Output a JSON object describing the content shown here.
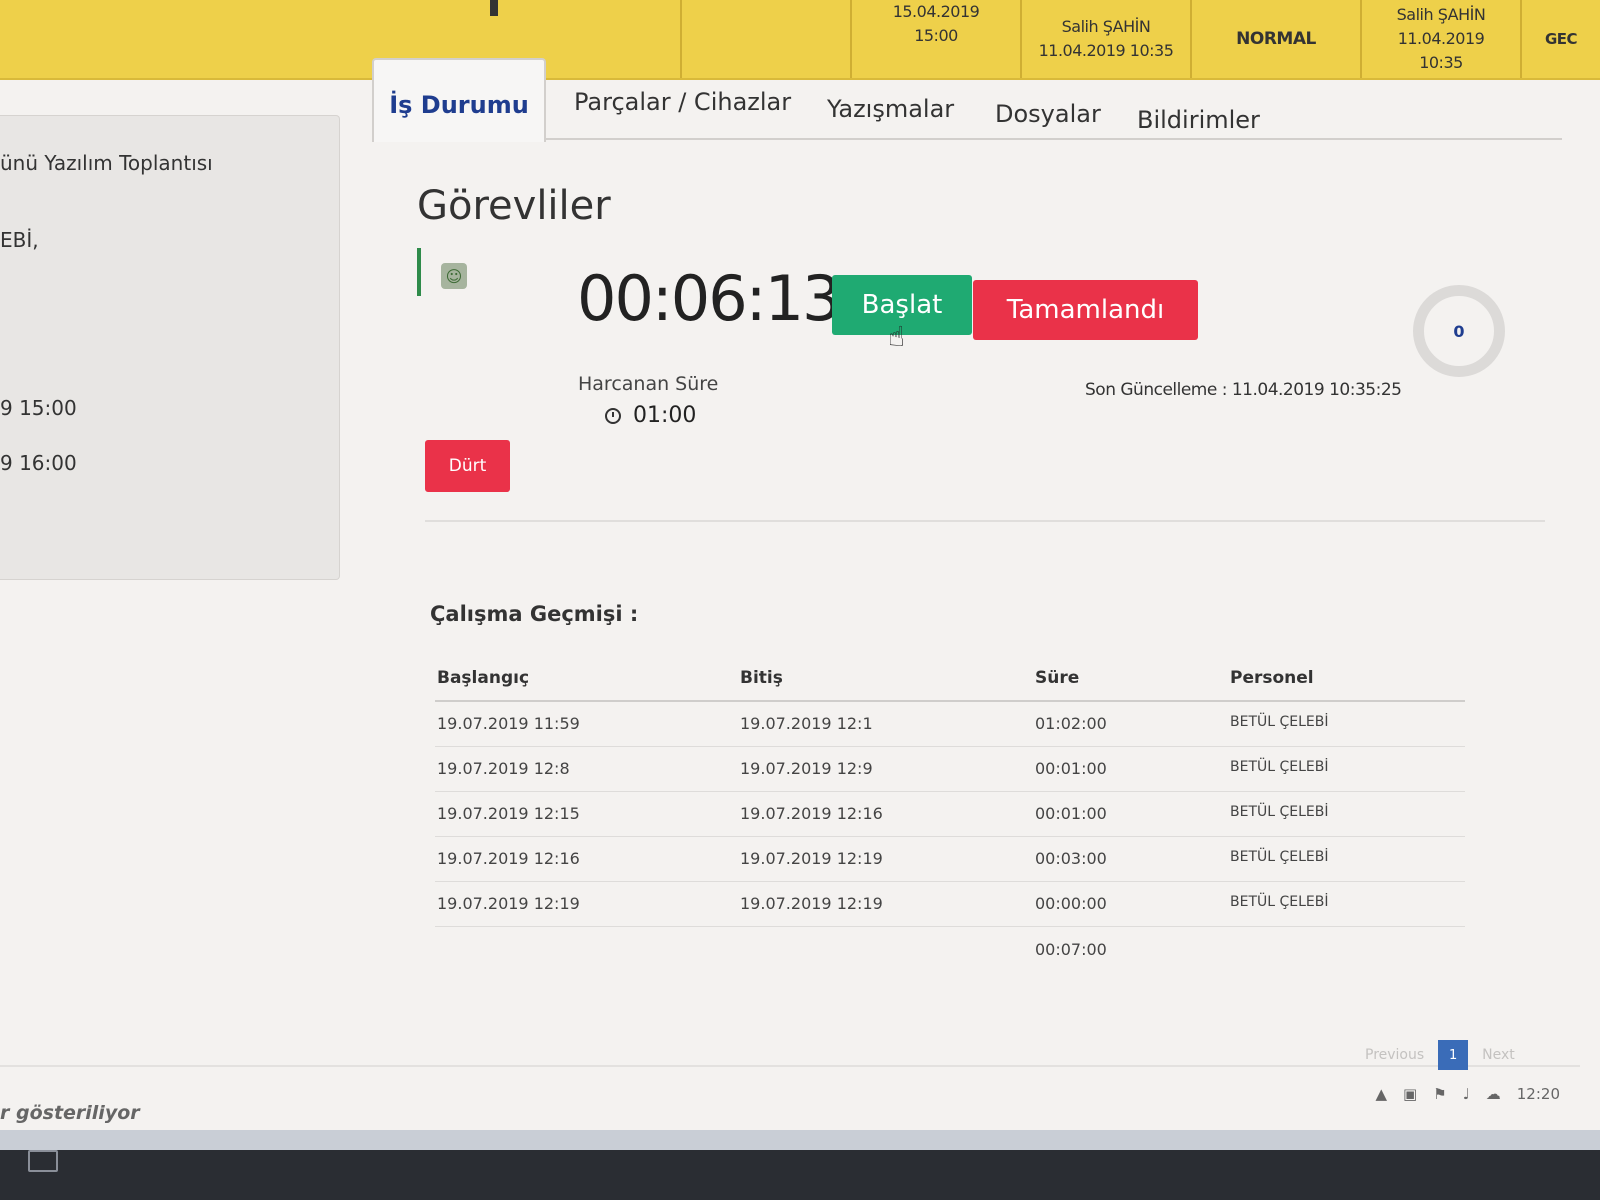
{
  "topbar": {
    "date1": "15.04.2019",
    "time1": "15:00",
    "user1": "Salih ŞAHİN",
    "stamp1": "11.04.2019 10:35",
    "priority": "NORMAL",
    "user2": "Salih ŞAHİN",
    "date2": "11.04.2019",
    "time2": "10:35",
    "extra": "GEC"
  },
  "left_panel": {
    "title_fragment": "ünü Yazılım Toplantısı",
    "name_fragment": "EBİ,",
    "start_fragment": "9 15:00",
    "end_fragment": "9 16:00"
  },
  "tabs": [
    {
      "label": "İş Durumu",
      "active": true
    },
    {
      "label": "Parçalar / Cihazlar"
    },
    {
      "label": "Yazışmalar"
    },
    {
      "label": "Dosyalar"
    },
    {
      "label": "Bildirimler"
    }
  ],
  "section_title": "Görevliler",
  "timer": "00:06:13",
  "buttons": {
    "start": "Başlat",
    "done": "Tamamlandı",
    "stop": "Dürt"
  },
  "spent": {
    "label": "Harcanan Süre",
    "value": "01:00"
  },
  "last_update": "Son Güncelleme : 11.04.2019 10:35:25",
  "ring_value": "0",
  "history": {
    "title": "Çalışma Geçmişi :",
    "columns": [
      "Başlangıç",
      "Bitiş",
      "Süre",
      "Personel"
    ],
    "rows": [
      [
        "19.07.2019 11:59",
        "19.07.2019 12:1",
        "01:02:00",
        "BETÜL ÇELEBİ"
      ],
      [
        "19.07.2019 12:8",
        "19.07.2019 12:9",
        "00:01:00",
        "BETÜL ÇELEBİ"
      ],
      [
        "19.07.2019 12:15",
        "19.07.2019 12:16",
        "00:01:00",
        "BETÜL ÇELEBİ"
      ],
      [
        "19.07.2019 12:16",
        "19.07.2019 12:19",
        "00:03:00",
        "BETÜL ÇELEBİ"
      ],
      [
        "19.07.2019 12:19",
        "19.07.2019 12:19",
        "00:00:00",
        "BETÜL ÇELEBİ"
      ]
    ],
    "total": "00:07:00"
  },
  "pager": {
    "previous": "Previous",
    "page": "1",
    "next": "Next"
  },
  "footer_fragment": "r gösteriliyor",
  "tray_time": "12:20"
}
